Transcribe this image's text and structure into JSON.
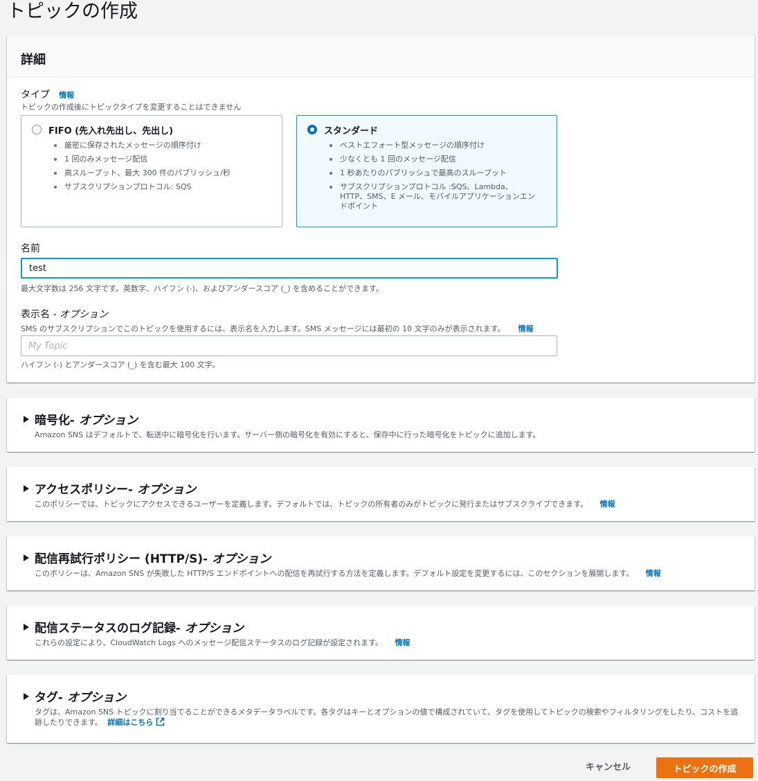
{
  "page_title": "トピックの作成",
  "details": {
    "header": "詳細",
    "type_label": "タイプ",
    "type_info": "情報",
    "type_desc": "トピックの作成後にトピックタイプを変更することはできません",
    "fifo": {
      "title": "FIFO (先入れ先出し、先出し)",
      "items": [
        "厳密に保存されたメッセージの順序付け",
        "1 回のみメッセージ配信",
        "高スループット、最大 300 件のパブリッシュ/秒",
        "サブスクリプションプロトコル: SQS"
      ]
    },
    "standard": {
      "title": "スタンダード",
      "items": [
        "ベストエフォート型メッセージの順序付け",
        "少なくとも 1 回のメッセージ配信",
        "1 秒あたりのパブリッシュで最高のスループット",
        "サブスクリプションプロトコル :SQS、Lambda、HTTP、SMS、E メール、モバイルアプリケーションエンドポイント"
      ]
    },
    "name_label": "名前",
    "name_value": "test",
    "name_hint": "最大文字数は 256 文字です。英数字、ハイフン (-)、およびアンダースコア (_) を含めることができます。",
    "display_label": "表示名",
    "display_label_opt": " - オプション",
    "display_desc": "SMS のサブスクリプションでこのトピックを使用するには、表示名を入力します。SMS メッセージには最初の 10 文字のみが表示されます。",
    "display_info": "情報",
    "display_placeholder": "My Topic",
    "display_hint": "ハイフン (-) とアンダースコア (_) を含む最大 100 文字。"
  },
  "sections": {
    "encryption": {
      "title": "暗号化",
      "opt": " - オプション",
      "desc": "Amazon SNS はデフォルトで、転送中に暗号化を行います。サーバー側の暗号化を有効にすると、保存中に行った暗号化をトピックに追加します。"
    },
    "access": {
      "title": "アクセスポリシー",
      "opt": " - オプション",
      "desc": "このポリシーでは、トピックにアクセスできるユーザーを定義します。デフォルトでは、トピックの所有者のみがトピックに発行またはサブスクライブできます。",
      "info": "情報"
    },
    "retry": {
      "title": "配信再試行ポリシー (HTTP/S)",
      "opt": " - オプション",
      "desc": "このポリシーは、Amazon SNS が失敗した HTTP/S エンドポイントへの配信を再試行する方法を定義します。デフォルト設定を変更するには、このセクションを展開します。",
      "info": "情報"
    },
    "logging": {
      "title": "配信ステータスのログ記録",
      "opt": " - オプション",
      "desc": "これらの設定により、CloudWatch Logs へのメッセージ配信ステータスのログ記録が設定されます。",
      "info": "情報"
    },
    "tags": {
      "title": "タグ",
      "opt": " - オプション",
      "desc": "タグは、Amazon SNS トピックに割り当てることができるメタデータラベルです。各タグはキーとオプションの値で構成されていて、タグを使用してトピックの検索やフィルタリングをしたり、コストを追跡したりできます。",
      "link": "詳細はこちら"
    }
  },
  "footer": {
    "cancel": "キャンセル",
    "create": "トピックの作成"
  },
  "colors": {
    "primary": "#ec7211",
    "link": "#0073bb",
    "selected_border": "#00a1c9"
  }
}
